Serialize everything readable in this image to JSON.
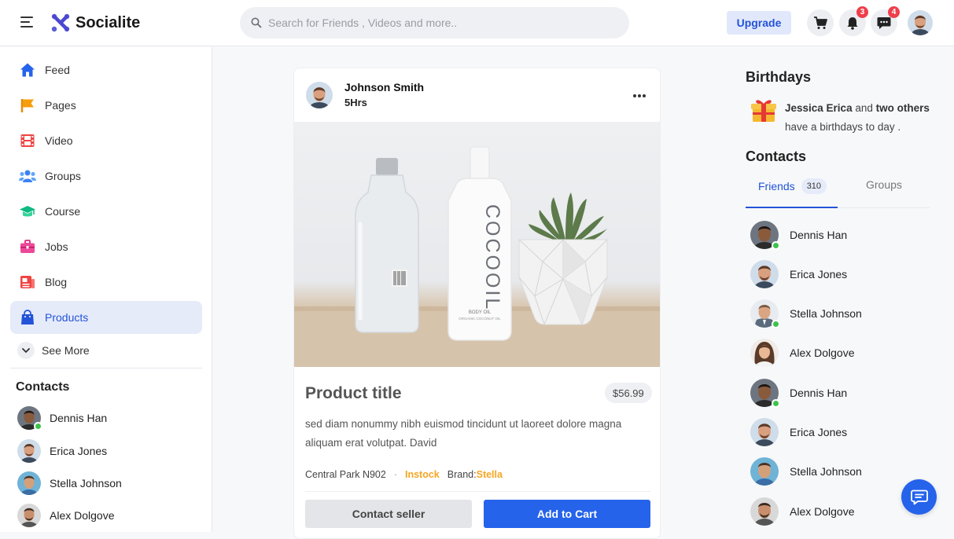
{
  "app": {
    "name": "Socialite"
  },
  "search": {
    "placeholder": "Search for Friends , Videos and more.."
  },
  "header": {
    "upgrade_label": "Upgrade",
    "notifications_count": "3",
    "messages_count": "4"
  },
  "sidebar": {
    "items": [
      {
        "label": "Feed",
        "icon": "home-icon",
        "color": "#2563eb"
      },
      {
        "label": "Pages",
        "icon": "flag-icon",
        "color": "#f59e0b"
      },
      {
        "label": "Video",
        "icon": "film-icon",
        "color": "#ef4444"
      },
      {
        "label": "Groups",
        "icon": "users-icon",
        "color": "#3b82f6"
      },
      {
        "label": "Course",
        "icon": "graduation-cap-icon",
        "color": "#10b981"
      },
      {
        "label": "Jobs",
        "icon": "briefcase-icon",
        "color": "#ec4899"
      },
      {
        "label": "Blog",
        "icon": "blog-icon",
        "color": "#ef4444"
      },
      {
        "label": "Products",
        "icon": "shopping-bag-icon",
        "color": "#2353d8",
        "active": true
      }
    ],
    "see_more": "See More",
    "contacts_title": "Contacts",
    "contacts": [
      {
        "name": "Dennis Han",
        "online": true
      },
      {
        "name": "Erica Jones",
        "online": false
      },
      {
        "name": "Stella Johnson",
        "online": false
      },
      {
        "name": "Alex Dolgove",
        "online": false
      }
    ]
  },
  "post": {
    "author": "Johnson Smith",
    "time": "5Hrs",
    "image_label": "COCOOIL",
    "image_sub1": "BODY OIL",
    "image_sub2": "ORGANIC COCONUT OIL",
    "product_title": "Product title",
    "price": "$56.99",
    "description": "sed diam nonummy nibh euismod tincidunt ut laoreet dolore magna aliquam erat volutpat. David",
    "location": "Central Park N902",
    "separator": "·",
    "stock_status": "Instock",
    "brand_label": "Brand:",
    "brand_value": "Stella",
    "contact_seller": "Contact seller",
    "add_to_cart": "Add to Cart"
  },
  "right": {
    "birthdays_title": "Birthdays",
    "birthday_name": "Jessica Erica",
    "birthday_and": "and",
    "birthday_others": "two others",
    "birthday_rest": "have a birthdays to day .",
    "contacts_title": "Contacts",
    "tabs": [
      {
        "label": "Friends",
        "count": "310",
        "active": true
      },
      {
        "label": "Groups",
        "active": false
      }
    ],
    "contacts": [
      {
        "name": "Dennis Han",
        "online": true
      },
      {
        "name": "Erica Jones",
        "online": false
      },
      {
        "name": "Stella Johnson",
        "online": true
      },
      {
        "name": "Alex Dolgove",
        "online": false
      },
      {
        "name": "Dennis Han",
        "online": true
      },
      {
        "name": "Erica Jones",
        "online": false
      },
      {
        "name": "Stella Johnson",
        "online": false
      },
      {
        "name": "Alex Dolgove",
        "online": false
      }
    ]
  },
  "colors": {
    "accent": "#2563eb",
    "accent_dark": "#2353d8",
    "stock": "#f5a623",
    "online": "#3cc34a",
    "badge": "#ef3e4a"
  }
}
